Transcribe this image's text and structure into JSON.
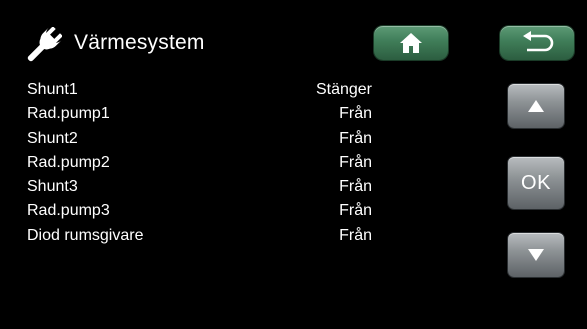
{
  "header": {
    "title": "Värmesystem",
    "icon": "wrench-icon",
    "home_icon": "home-icon",
    "back_icon": "back-arrow-icon",
    "button_color": "#3f7d58"
  },
  "rows": [
    {
      "label": "Shunt1",
      "value": "Stänger"
    },
    {
      "label": "Rad.pump1",
      "value": "Från"
    },
    {
      "label": "Shunt2",
      "value": "Från"
    },
    {
      "label": "Rad.pump2",
      "value": "Från"
    },
    {
      "label": "Shunt3",
      "value": "Från"
    },
    {
      "label": "Rad.pump3",
      "value": "Från"
    },
    {
      "label": "Diod rumsgivare",
      "value": "Från"
    }
  ],
  "nav": {
    "up_icon": "arrow-up-icon",
    "ok_label": "OK",
    "down_icon": "arrow-down-icon",
    "button_color": "#8e9396"
  }
}
